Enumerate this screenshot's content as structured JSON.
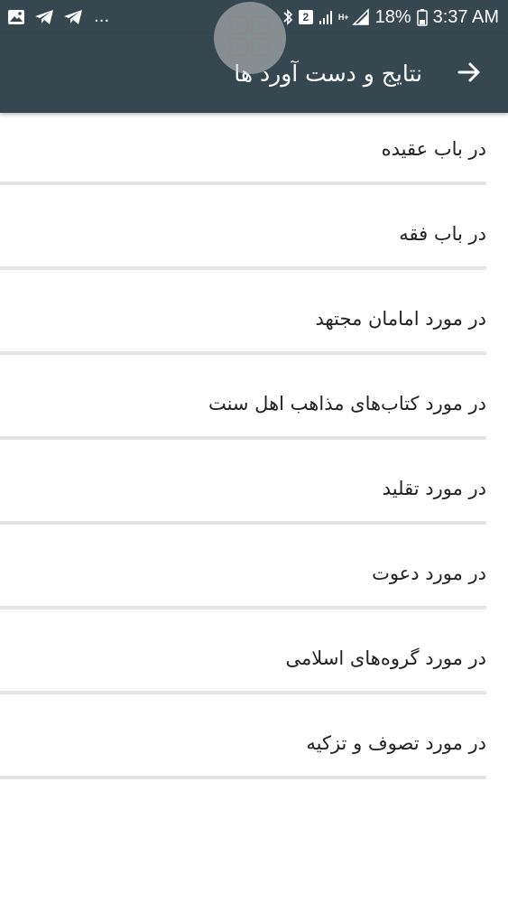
{
  "status_bar": {
    "battery": "18%",
    "time": "3:37 AM",
    "sim": "2",
    "network_type": "H+",
    "more_notifications": "...",
    "notification_icons": [
      "image-icon",
      "telegram-icon",
      "telegram-icon"
    ],
    "system_icons": [
      "bluetooth-icon",
      "sim-2-icon",
      "signal-icon",
      "signal-icon",
      "battery-icon"
    ]
  },
  "app_bar": {
    "title": "نتایج و دست آورد ها",
    "back_icon": "arrow-right-icon",
    "background": "#37474f"
  },
  "floating_button": {
    "icon": "grid-icon"
  },
  "list": {
    "items": [
      {
        "label": "در باب عقیده"
      },
      {
        "label": "در باب فقه"
      },
      {
        "label": "در مورد امامان مجتهد"
      },
      {
        "label": "در مورد کتاب‌های مذاهب اهل سنت"
      },
      {
        "label": "در مورد تقلید"
      },
      {
        "label": "در مورد دعوت"
      },
      {
        "label": "در مورد گروه‌های اسلامی"
      },
      {
        "label": "در مورد تصوف و تزکیه"
      }
    ]
  }
}
